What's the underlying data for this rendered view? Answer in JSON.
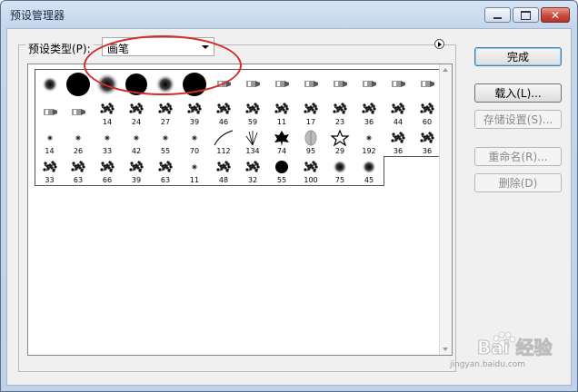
{
  "window": {
    "title": "预设管理器"
  },
  "preset": {
    "label": "预设类型(P):",
    "type_value": "画笔"
  },
  "brushes": [
    {
      "row": 0,
      "col": 0,
      "kind": "soft",
      "size": 9
    },
    {
      "row": 0,
      "col": 1,
      "kind": "hard",
      "size": 26
    },
    {
      "row": 0,
      "col": 2,
      "kind": "soft",
      "size": 13
    },
    {
      "row": 0,
      "col": 3,
      "kind": "hard",
      "size": 24
    },
    {
      "row": 0,
      "col": 4,
      "kind": "soft",
      "size": 11
    },
    {
      "row": 0,
      "col": 5,
      "kind": "hard",
      "size": 26
    },
    {
      "row": 0,
      "col": 6,
      "kind": "tool"
    },
    {
      "row": 0,
      "col": 7,
      "kind": "tool"
    },
    {
      "row": 0,
      "col": 8,
      "kind": "tool"
    },
    {
      "row": 0,
      "col": 9,
      "kind": "tool"
    },
    {
      "row": 0,
      "col": 10,
      "kind": "tool"
    },
    {
      "row": 0,
      "col": 11,
      "kind": "tool"
    },
    {
      "row": 0,
      "col": 12,
      "kind": "tool"
    },
    {
      "row": 0,
      "col": 13,
      "kind": "tool"
    },
    {
      "row": 1,
      "col": 0,
      "kind": "tool"
    },
    {
      "row": 1,
      "col": 1,
      "kind": "tool"
    },
    {
      "row": 1,
      "col": 2,
      "kind": "splat",
      "num": "14"
    },
    {
      "row": 1,
      "col": 3,
      "kind": "splat",
      "num": "24"
    },
    {
      "row": 1,
      "col": 4,
      "kind": "splat",
      "num": "27"
    },
    {
      "row": 1,
      "col": 5,
      "kind": "splat",
      "num": "39"
    },
    {
      "row": 1,
      "col": 6,
      "kind": "splat",
      "num": "46"
    },
    {
      "row": 1,
      "col": 7,
      "kind": "splat",
      "num": "59"
    },
    {
      "row": 1,
      "col": 8,
      "kind": "splat",
      "num": "11"
    },
    {
      "row": 1,
      "col": 9,
      "kind": "splat",
      "num": "17"
    },
    {
      "row": 1,
      "col": 10,
      "kind": "splat",
      "num": "23"
    },
    {
      "row": 1,
      "col": 11,
      "kind": "splat",
      "num": "36"
    },
    {
      "row": 1,
      "col": 12,
      "kind": "splat",
      "num": "44"
    },
    {
      "row": 1,
      "col": 13,
      "kind": "splat",
      "num": "60"
    },
    {
      "row": 2,
      "col": 0,
      "kind": "star",
      "num": "14"
    },
    {
      "row": 2,
      "col": 1,
      "kind": "star",
      "num": "26"
    },
    {
      "row": 2,
      "col": 2,
      "kind": "star",
      "num": "33"
    },
    {
      "row": 2,
      "col": 3,
      "kind": "star",
      "num": "42"
    },
    {
      "row": 2,
      "col": 4,
      "kind": "star",
      "num": "55"
    },
    {
      "row": 2,
      "col": 5,
      "kind": "star",
      "num": "70"
    },
    {
      "row": 2,
      "col": 6,
      "kind": "stroke",
      "num": "112"
    },
    {
      "row": 2,
      "col": 7,
      "kind": "grass",
      "num": "134"
    },
    {
      "row": 2,
      "col": 8,
      "kind": "leaf",
      "num": "74"
    },
    {
      "row": 2,
      "col": 9,
      "kind": "leaf2",
      "num": "95"
    },
    {
      "row": 2,
      "col": 10,
      "kind": "outline-star",
      "num": "29"
    },
    {
      "row": 2,
      "col": 11,
      "kind": "star",
      "num": "192"
    },
    {
      "row": 2,
      "col": 12,
      "kind": "splat",
      "num": "36"
    },
    {
      "row": 2,
      "col": 13,
      "kind": "splat",
      "num": "36"
    },
    {
      "row": 3,
      "col": 0,
      "kind": "splat",
      "num": "33"
    },
    {
      "row": 3,
      "col": 1,
      "kind": "splat",
      "num": "63"
    },
    {
      "row": 3,
      "col": 2,
      "kind": "splat",
      "num": "66"
    },
    {
      "row": 3,
      "col": 3,
      "kind": "splat",
      "num": "39"
    },
    {
      "row": 3,
      "col": 4,
      "kind": "splat",
      "num": "63"
    },
    {
      "row": 3,
      "col": 5,
      "kind": "star",
      "num": "11"
    },
    {
      "row": 3,
      "col": 6,
      "kind": "splat",
      "num": "48"
    },
    {
      "row": 3,
      "col": 7,
      "kind": "splat",
      "num": "32"
    },
    {
      "row": 3,
      "col": 8,
      "kind": "hard",
      "size": 14,
      "num": "55"
    },
    {
      "row": 3,
      "col": 9,
      "kind": "splat",
      "num": "100"
    },
    {
      "row": 3,
      "col": 10,
      "kind": "soft",
      "size": 8,
      "num": "75"
    },
    {
      "row": 3,
      "col": 11,
      "kind": "soft",
      "size": 8,
      "num": "45"
    }
  ],
  "buttons": {
    "done": "完成",
    "load": "载入(L)...",
    "save_set": "存储设置(S)...",
    "rename": "重命名(R)...",
    "delete": "删除(D)"
  },
  "watermark": {
    "logo": "Bai 经验",
    "url": "jingyan.baidu.com"
  },
  "colors": {
    "annotation": "#d62b2b",
    "title_gradient_top": "#d7e4f3",
    "close_button": "#c9473a"
  }
}
